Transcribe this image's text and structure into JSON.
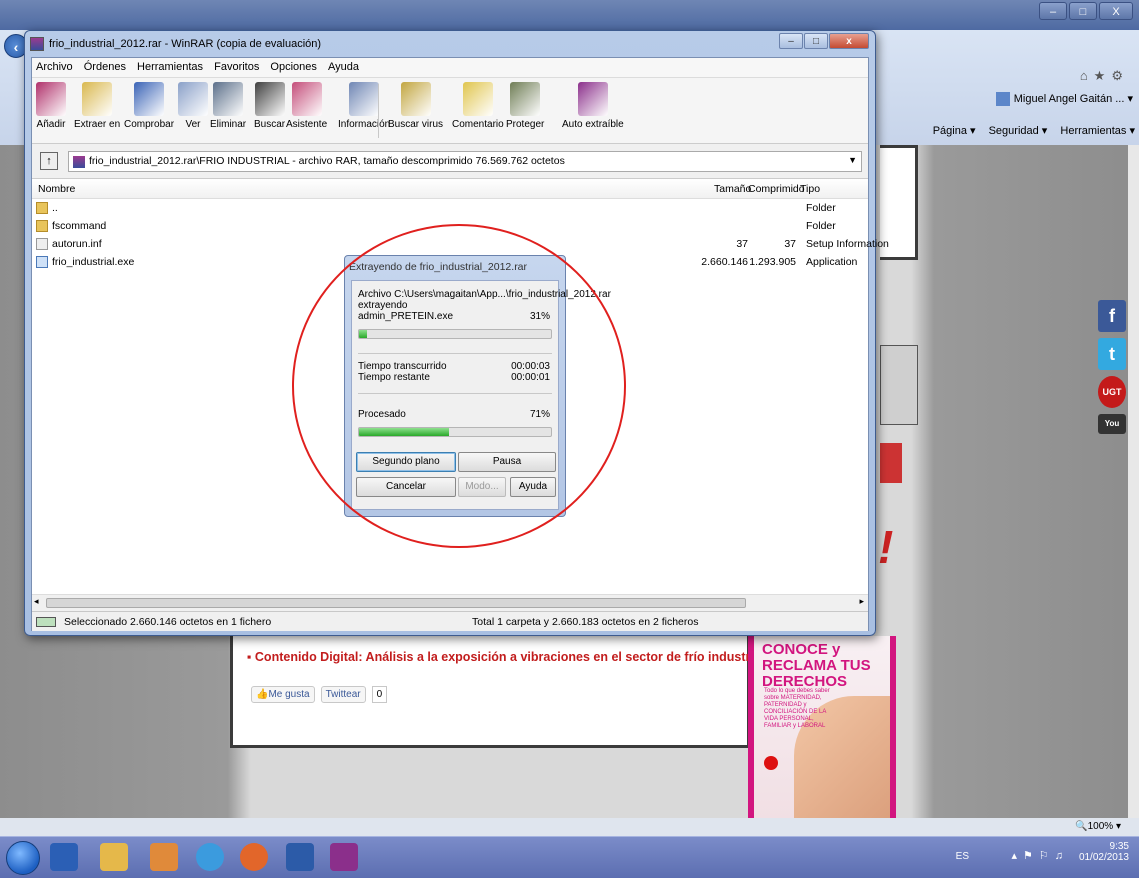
{
  "browser": {
    "window_controls": [
      "–",
      "□",
      "X"
    ],
    "user": "Miguel Angel Gaitán ...",
    "cmdbar": [
      "Página ▾",
      "Seguridad ▾",
      "Herramientas ▾"
    ],
    "zoom": "100%"
  },
  "winrar": {
    "title": "frio_industrial_2012.rar - WinRAR (copia de evaluación)",
    "menu": [
      "Archivo",
      "Órdenes",
      "Herramientas",
      "Favoritos",
      "Opciones",
      "Ayuda"
    ],
    "toolbar": [
      {
        "label": "Añadir",
        "icon": "add-books-icon",
        "color": "#b0306a"
      },
      {
        "label": "Extraer en",
        "icon": "extract-icon",
        "color": "#d9b84e"
      },
      {
        "label": "Comprobar",
        "icon": "test-icon",
        "color": "#3a63b6"
      },
      {
        "label": "Ver",
        "icon": "view-glasses-icon",
        "color": "#8aa0c8"
      },
      {
        "label": "Eliminar",
        "icon": "delete-icon",
        "color": "#5b6f8a"
      },
      {
        "label": "Buscar",
        "icon": "binoculars-icon",
        "color": "#3f3f3f"
      },
      {
        "label": "Asistente",
        "icon": "wizard-icon",
        "color": "#c44d7a"
      },
      {
        "label": "Información",
        "icon": "info-icon",
        "color": "#6f86b4"
      },
      {
        "label": "Buscar virus",
        "icon": "virus-scan-icon",
        "color": "#c2a640"
      },
      {
        "label": "Comentario",
        "icon": "comment-icon",
        "color": "#e0c54d"
      },
      {
        "label": "Proteger",
        "icon": "protect-shield-icon",
        "color": "#6f7d55"
      },
      {
        "label": "Auto extraíble",
        "icon": "sfx-icon",
        "color": "#8b2f8b"
      }
    ],
    "path": "frio_industrial_2012.rar\\FRIO INDUSTRIAL - archivo RAR, tamaño descomprimido 76.569.762 octetos",
    "columns": {
      "name": "Nombre",
      "size": "Tamaño",
      "packed": "Comprimido",
      "type": "Tipo"
    },
    "files": [
      {
        "name": "..",
        "size": "",
        "packed": "",
        "type": "Folder",
        "icon": "folder"
      },
      {
        "name": "fscommand",
        "size": "",
        "packed": "",
        "type": "Folder",
        "icon": "folder"
      },
      {
        "name": "autorun.inf",
        "size": "37",
        "packed": "37",
        "type": "Setup Information",
        "icon": "inf"
      },
      {
        "name": "frio_industrial.exe",
        "size": "2.660.146",
        "packed": "1.293.905",
        "type": "Application",
        "icon": "exe"
      }
    ],
    "status_left": "Seleccionado 2.660.146 octetos en 1 fichero",
    "status_right": "Total 1 carpeta y 2.660.183 octetos en 2 ficheros"
  },
  "extract_dialog": {
    "title": "Extrayendo de frio_industrial_2012.rar",
    "archive_line": "Archivo C:\\Users\\magaitan\\App...\\frio_industrial_2012.rar",
    "action": "extrayendo",
    "current_file": "admin_PRETEIN.exe",
    "file_pct": "31%",
    "file_progress": 0.04,
    "elapsed_label": "Tiempo transcurrido",
    "elapsed": "00:00:03",
    "remaining_label": "Tiempo restante",
    "remaining": "00:00:01",
    "processed_label": "Procesado",
    "processed_pct": "71%",
    "processed_progress": 0.47,
    "buttons": {
      "background": "Segundo plano",
      "pause": "Pausa",
      "cancel": "Cancelar",
      "mode": "Modo...",
      "help": "Ayuda"
    }
  },
  "page": {
    "article_title": "Contenido Digital: Análisis a la exposición a vibraciones en el sector de frío industrial",
    "like": "Me gusta",
    "tweet": "Twittear",
    "tweet_count": "0",
    "ad_title": "CONOCE y RECLAMA TUS DERECHOS",
    "ad_text": "Todo lo que debes saber sobre MATERNIDAD, PATERNIDAD y CONCILIACIÓN DE LA VIDA PERSONAL, FAMILIAR y LABORAL",
    "exclaim": "!"
  },
  "taskbar": {
    "lang": "ES",
    "time": "9:35",
    "date": "01/02/2013"
  }
}
